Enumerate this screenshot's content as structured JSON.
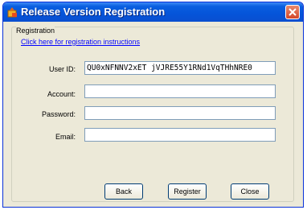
{
  "window": {
    "title": "Release Version Registration"
  },
  "group": {
    "label": "Registration"
  },
  "link": {
    "text": "Click here for registration instructions"
  },
  "fields": {
    "user_id": {
      "label": "User ID:",
      "value": "QU0xNFNNV2xET jVJRE55Y1RNd1VqTHhNRE0"
    },
    "account": {
      "label": "Account:",
      "value": ""
    },
    "password": {
      "label": "Password:",
      "value": ""
    },
    "email": {
      "label": "Email:",
      "value": ""
    }
  },
  "buttons": {
    "back": "Back",
    "register": "Register",
    "close": "Close"
  },
  "colors": {
    "titlebar": "#0554d9",
    "close": "#d3472a",
    "face": "#ece9d8",
    "link": "#0000ff"
  }
}
